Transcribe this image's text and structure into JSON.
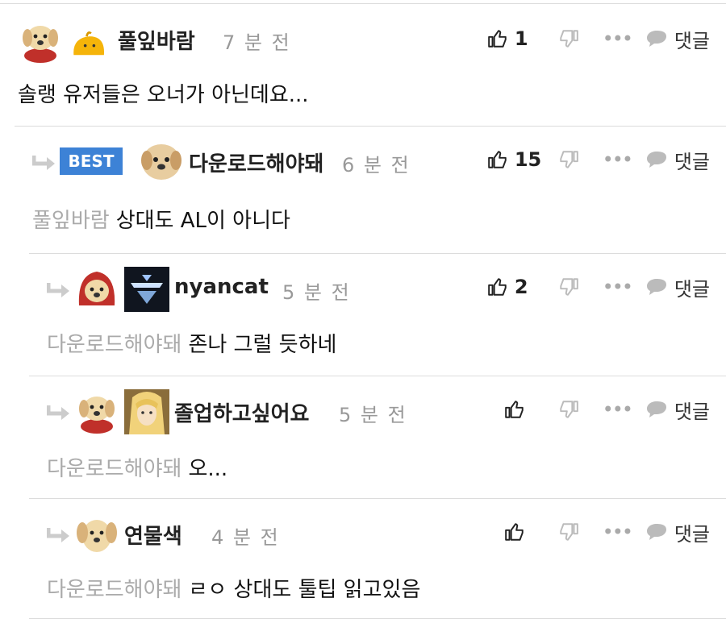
{
  "comments": [
    {
      "nickname": "풀잎바람",
      "time": "7 분 전",
      "likes": "1",
      "reply_label": "댓글",
      "text": "솔랭 유저들은 오너가 아닌데요..."
    },
    {
      "badge": "BEST",
      "nickname": "다운로드해야돼",
      "time": "6 분 전",
      "likes": "15",
      "reply_label": "댓글",
      "mention": "풀잎바람",
      "text": "상대도 AL이 아니다"
    },
    {
      "nickname": "nyancat",
      "time": "5 분 전",
      "likes": "2",
      "reply_label": "댓글",
      "mention": "다운로드해야돼",
      "text": "존나 그럴 듯하네"
    },
    {
      "nickname": "졸업하고싶어요",
      "time": "5 분 전",
      "likes": "",
      "reply_label": "댓글",
      "mention": "다운로드해야돼",
      "text": "오..."
    },
    {
      "nickname": "연물색",
      "time": "4 분 전",
      "likes": "",
      "reply_label": "댓글",
      "mention": "다운로드해야돼",
      "text": "ㄹㅇ 상대도 툴팁 읽고있음"
    }
  ],
  "more_glyph": "•••",
  "colors": {
    "best_badge": "#3d82d6",
    "mention": "#aaaaaa",
    "time": "#999999"
  }
}
